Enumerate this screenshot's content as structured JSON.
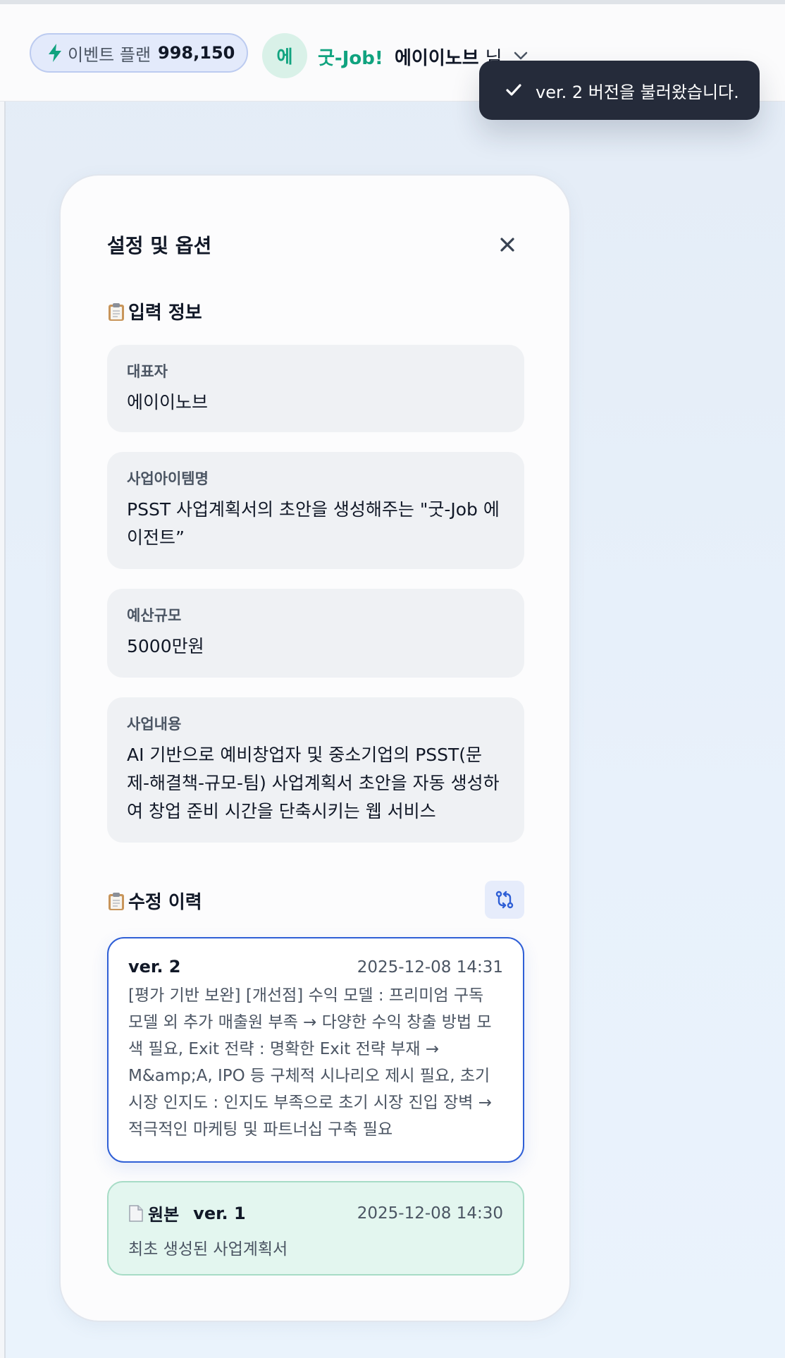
{
  "header": {
    "plan_label": "이벤트 플랜",
    "plan_points": "998,150",
    "avatar_initial": "에",
    "brand": "굿-Job!",
    "username": "에이이노브",
    "username_suffix": "님"
  },
  "toast": {
    "message": "ver. 2 버전을 불러왔습니다."
  },
  "panel": {
    "title": "설정 및 옵션",
    "input_section_title": "입력 정보",
    "input_fields": [
      {
        "label": "대표자",
        "value": "에이이노브"
      },
      {
        "label": "사업아이템명",
        "value": "PSST 사업계획서의 초안을 생성해주는 \"굿-Job 에이전트”"
      },
      {
        "label": "예산규모",
        "value": "5000만원"
      },
      {
        "label": "사업내용",
        "value": "AI 기반으로 예비창업자 및 중소기업의 PSST(문제-해결책-규모-팀) 사업계획서 초안을 자동 생성하여 창업 준비 시간을 단축시키는 웹 서비스"
      }
    ],
    "history_section_title": "수정 이력",
    "versions": [
      {
        "name": "ver. 2",
        "date": "2025-12-08 14:31",
        "description": "[평가 기반 보완] [개선점] 수익 모델 : 프리미엄 구독 모델 외 추가 매출원 부족 → 다양한 수익 창출 방법 모색 필요, Exit 전략 : 명확한 Exit 전략 부재 → M&amp;A, IPO 등 구체적 시나리오 제시 필요, 초기 시장 인지도 : 인지도 부족으로 초기 시장 진입 장벽 → 적극적인 마케팅 및 파트너십 구축 필요"
      },
      {
        "badge": "원본",
        "name": "ver. 1",
        "date": "2025-12-08 14:30",
        "description": "최초 생성된 사업계획서"
      }
    ]
  },
  "colors": {
    "accent_green": "#10a37f",
    "accent_blue": "#2f5fd6",
    "toast_bg": "#252b3a"
  }
}
